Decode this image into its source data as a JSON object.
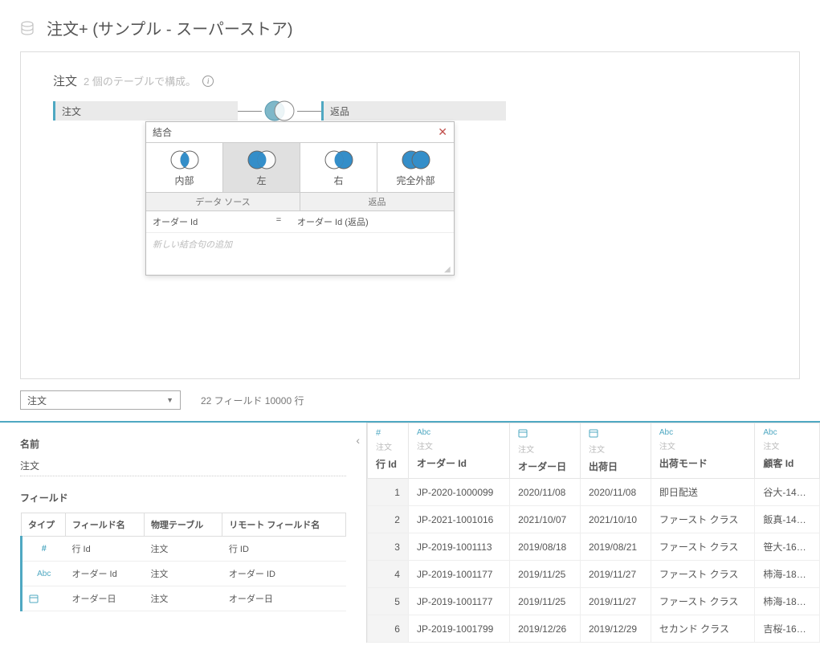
{
  "header": {
    "title": "注文+ (サンプル - スーパーストア)"
  },
  "canvas": {
    "title": "注文",
    "subtitle": "2 個のテーブルで構成。",
    "table_left": "注文",
    "table_right": "返品"
  },
  "join_popup": {
    "title": "結合",
    "types": {
      "inner": "内部",
      "left": "左",
      "right": "右",
      "full": "完全外部"
    },
    "col_left": "データ ソース",
    "col_right": "返品",
    "clause": {
      "left": "オーダー Id",
      "op": "=",
      "right": "オーダー Id (返品)"
    },
    "add_hint": "新しい結合句の追加"
  },
  "lower_bar": {
    "select_value": "注文",
    "summary": "22 フィールド 10000 行"
  },
  "left_pane": {
    "name_label": "名前",
    "name_value": "注文",
    "fields_label": "フィールド",
    "cols": {
      "type": "タイプ",
      "field": "フィールド名",
      "phys": "物理テーブル",
      "remote": "リモート フィールド名"
    },
    "rows": [
      {
        "type": "#",
        "field": "行 Id",
        "phys": "注文",
        "remote": "行 ID"
      },
      {
        "type": "Abc",
        "field": "オーダー Id",
        "phys": "注文",
        "remote": "オーダー ID"
      },
      {
        "type": "date",
        "field": "オーダー日",
        "phys": "注文",
        "remote": "オーダー日"
      }
    ]
  },
  "grid": {
    "cols": [
      {
        "type": "#",
        "src": "注文",
        "name": "行 Id"
      },
      {
        "type": "Abc",
        "src": "注文",
        "name": "オーダー Id"
      },
      {
        "type": "date",
        "src": "注文",
        "name": "オーダー日"
      },
      {
        "type": "date",
        "src": "注文",
        "name": "出荷日"
      },
      {
        "type": "Abc",
        "src": "注文",
        "name": "出荷モード"
      },
      {
        "type": "Abc",
        "src": "注文",
        "name": "顧客 Id"
      }
    ],
    "rows": [
      {
        "n": "1",
        "oid": "JP-2020-1000099",
        "od": "2020/11/08",
        "sd": "2020/11/08",
        "sm": "即日配送",
        "cid": "谷大-14…"
      },
      {
        "n": "2",
        "oid": "JP-2021-1001016",
        "od": "2021/10/07",
        "sd": "2021/10/10",
        "sm": "ファースト クラス",
        "cid": "飯真-14…"
      },
      {
        "n": "3",
        "oid": "JP-2019-1001113",
        "od": "2019/08/18",
        "sd": "2019/08/21",
        "sm": "ファースト クラス",
        "cid": "笹大-16…"
      },
      {
        "n": "4",
        "oid": "JP-2019-1001177",
        "od": "2019/11/25",
        "sd": "2019/11/27",
        "sm": "ファースト クラス",
        "cid": "柿海-18…"
      },
      {
        "n": "5",
        "oid": "JP-2019-1001177",
        "od": "2019/11/25",
        "sd": "2019/11/27",
        "sm": "ファースト クラス",
        "cid": "柿海-18…"
      },
      {
        "n": "6",
        "oid": "JP-2019-1001799",
        "od": "2019/12/26",
        "sd": "2019/12/29",
        "sm": "セカンド クラス",
        "cid": "吉桜-16…"
      }
    ]
  }
}
